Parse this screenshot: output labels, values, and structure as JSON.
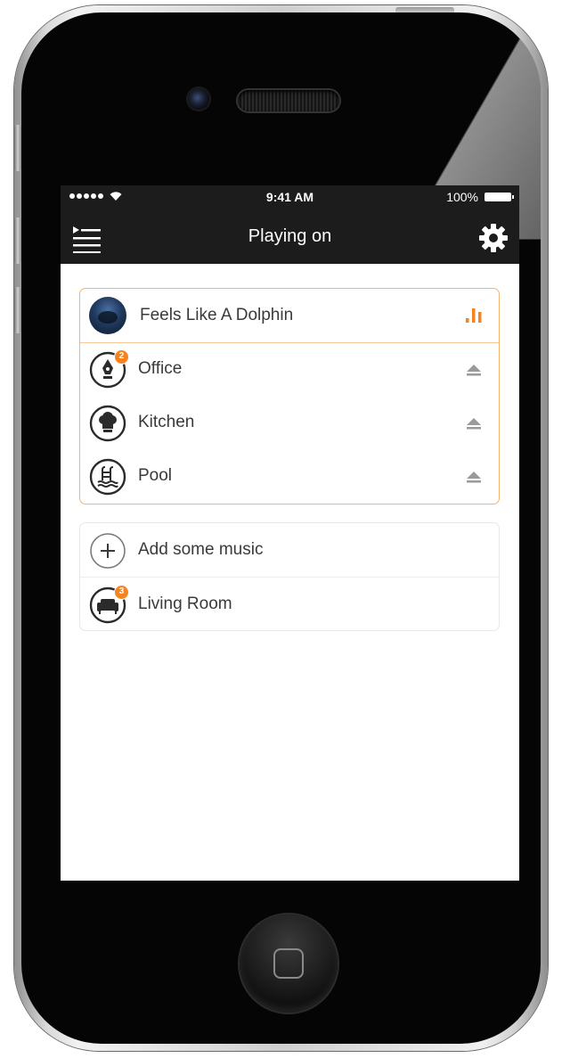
{
  "status_bar": {
    "time": "9:41 AM",
    "battery": "100%"
  },
  "nav": {
    "title": "Playing on",
    "menu_icon": "queue-list-icon",
    "settings_icon": "gear-icon"
  },
  "playing_group": {
    "now_playing": {
      "title": "Feels Like A Dolphin",
      "indicator_icon": "equalizer-bars-icon",
      "accent_color": "#f5841f"
    },
    "rooms": [
      {
        "label": "Office",
        "icon": "pen-nib-icon",
        "badge": "2",
        "action_icon": "eject-icon"
      },
      {
        "label": "Kitchen",
        "icon": "chef-hat-icon",
        "action_icon": "eject-icon"
      },
      {
        "label": "Pool",
        "icon": "pool-ladder-icon",
        "action_icon": "eject-icon"
      }
    ]
  },
  "idle_group": {
    "add_music": {
      "label": "Add some music",
      "icon": "plus-icon"
    },
    "rooms": [
      {
        "label": "Living Room",
        "icon": "sofa-icon",
        "badge": "3"
      }
    ]
  },
  "colors": {
    "accent": "#f5841f",
    "nav_background": "#1c1c1c",
    "group_border_active": "#f7b26f"
  }
}
